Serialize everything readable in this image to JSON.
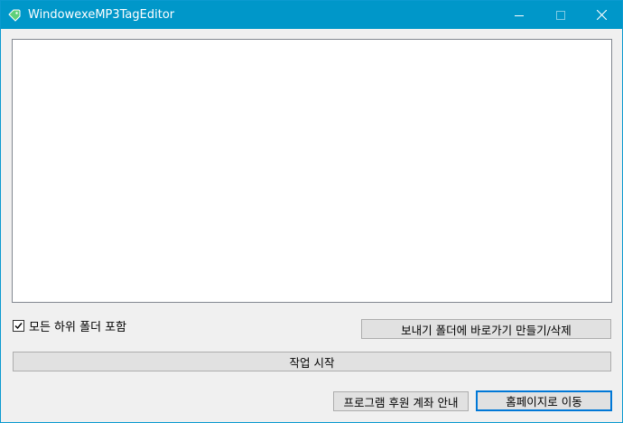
{
  "window": {
    "title": "WindowexeMP3TagEditor",
    "accent_color": "#0097c9",
    "app_icon": "tag-icon"
  },
  "controls": {
    "minimize_icon": "minimize-icon",
    "maximize_icon": "maximize-icon",
    "close_icon": "close-icon"
  },
  "options": {
    "include_subfolders_label": "모든 하위 폴더 포함",
    "include_subfolders_checked": true
  },
  "buttons": {
    "shortcut_label": "보내기 폴더에 바로가기 만들기/삭제",
    "start_label": "작업 시작",
    "donate_label": "프로그램 후원 계좌 안내",
    "homepage_label": "홈페이지로 이동"
  }
}
